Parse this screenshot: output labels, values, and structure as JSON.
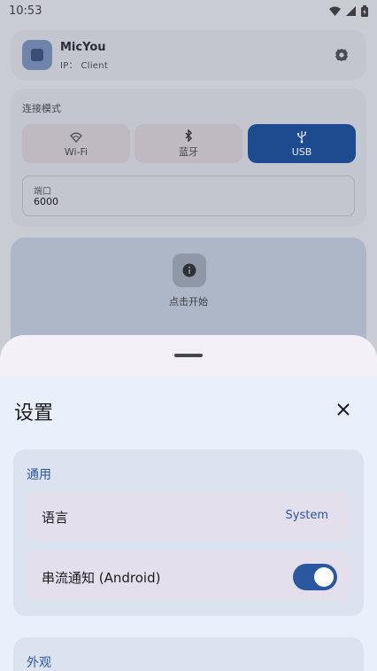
{
  "status_bar": {
    "time": "10:53"
  },
  "app": {
    "name": "MicYou",
    "subtitle": "IP： Client"
  },
  "mode": {
    "label": "连接模式",
    "options": [
      {
        "label": "Wi-Fi",
        "icon": "wifi-icon",
        "active": false
      },
      {
        "label": "蓝牙",
        "icon": "bluetooth-icon",
        "active": false
      },
      {
        "label": "USB",
        "icon": "usb-icon",
        "active": true
      }
    ]
  },
  "port": {
    "label": "端口",
    "value": "6000"
  },
  "start": {
    "label": "点击开始"
  },
  "settings": {
    "title": "设置",
    "general": {
      "title": "通用",
      "language_label": "语言",
      "language_value": "System",
      "notify_label": "串流通知 (Android)",
      "notify_enabled": true
    },
    "appearance": {
      "title": "外观"
    }
  },
  "colors": {
    "accent": "#2a579f",
    "active_mode": "#1e4b8f",
    "sheet_bg": "#eaf0fb"
  }
}
